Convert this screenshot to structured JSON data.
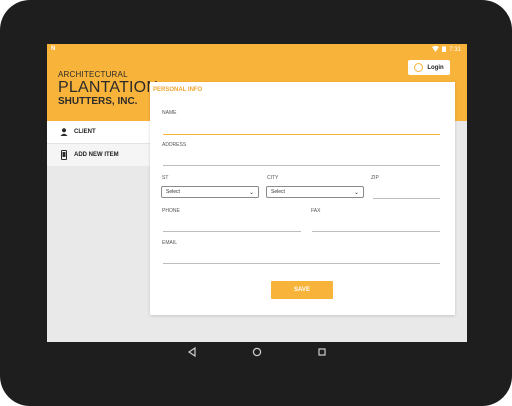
{
  "status_bar": {
    "time": "7:31",
    "left_icon": "app-notification-icon"
  },
  "header": {
    "brand_line1": "ARCHITECTURAL",
    "brand_line2": "PLANTATION",
    "brand_line3": "SHUTTERS, INC.",
    "login_label": "Login"
  },
  "sidebar": {
    "items": [
      {
        "label": "CLIENT",
        "icon": "person-icon",
        "active": true
      },
      {
        "label": "ADD NEW ITEM",
        "icon": "phone-icon",
        "active": false
      }
    ]
  },
  "form": {
    "section_title": "PERSONAL INFO",
    "name_label": "NAME",
    "address_label": "ADDRESS",
    "st_label": "ST",
    "city_label": "CITY",
    "zip_label": "ZIP",
    "st_select_value": "Select",
    "city_select_value": "Select",
    "phone_label": "PHONE",
    "fax_label": "FAX",
    "email_label": "EMAIL",
    "save_label": "SAVE"
  },
  "navigation": {
    "buttons": [
      "back-icon",
      "home-icon",
      "recents-icon"
    ]
  },
  "colors": {
    "accent": "#f8b33a",
    "bezel": "#1e1e1e"
  }
}
